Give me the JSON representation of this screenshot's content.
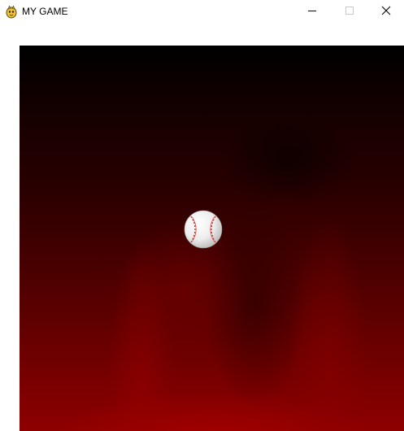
{
  "window": {
    "title": "MY GAME",
    "icon": "pygame-snake-icon",
    "controls": {
      "minimize": "minimize-icon",
      "maximize": "maximize-icon",
      "close": "close-icon"
    }
  },
  "game": {
    "background": "dark-red-smoke",
    "sprite": "baseball",
    "colors": {
      "background_top": "#000000",
      "background_bottom": "#8e0000",
      "ball": "#f2f2f2",
      "stitches": "#c0392b"
    }
  }
}
